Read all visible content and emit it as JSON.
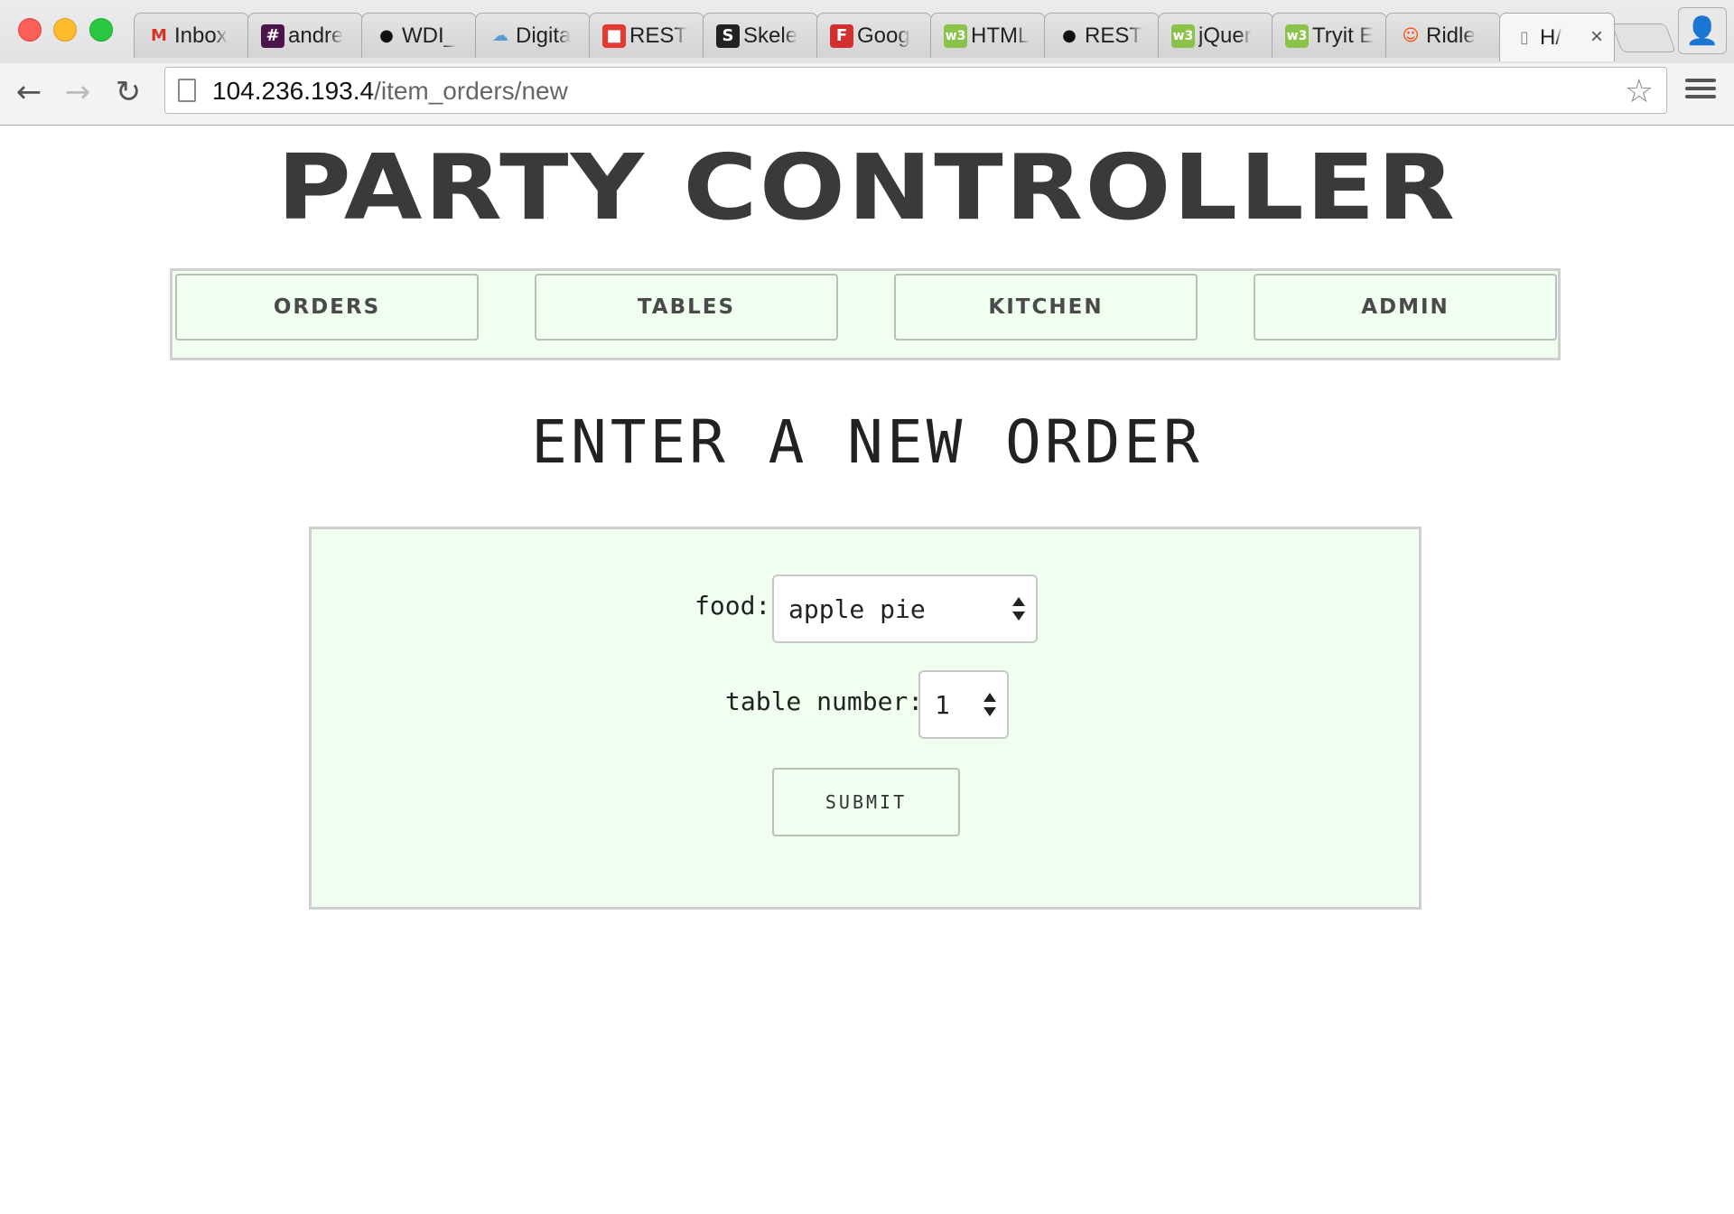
{
  "browser": {
    "tabs": [
      {
        "label": "Inbox",
        "icon": "gmail-icon",
        "icon_char": "M",
        "icon_color": "#d93025",
        "icon_bg": "transparent"
      },
      {
        "label": "andre",
        "icon": "slack-icon",
        "icon_char": "#",
        "icon_color": "#ffffff",
        "icon_bg": "#4a154b"
      },
      {
        "label": "WDI_",
        "icon": "github-icon",
        "icon_char": "●",
        "icon_color": "#111111",
        "icon_bg": "transparent"
      },
      {
        "label": "Digita",
        "icon": "cloud-icon",
        "icon_char": "☁",
        "icon_color": "#5b9bd5",
        "icon_bg": "transparent"
      },
      {
        "label": "REST",
        "icon": "rest-icon",
        "icon_char": "■",
        "icon_color": "#ffffff",
        "icon_bg": "#e53935"
      },
      {
        "label": "Skele",
        "icon": "skeleton-icon",
        "icon_char": "S",
        "icon_color": "#ffffff",
        "icon_bg": "#222222"
      },
      {
        "label": "Goog",
        "icon": "google-fonts-icon",
        "icon_char": "F",
        "icon_color": "#ffffff",
        "icon_bg": "#d32f2f"
      },
      {
        "label": "HTML",
        "icon": "w3schools-icon",
        "icon_char": "w3",
        "icon_color": "#ffffff",
        "icon_bg": "#8bc34a"
      },
      {
        "label": "REST",
        "icon": "github-icon",
        "icon_char": "●",
        "icon_color": "#111111",
        "icon_bg": "transparent"
      },
      {
        "label": "jQuer",
        "icon": "w3schools-icon",
        "icon_char": "w3",
        "icon_color": "#ffffff",
        "icon_bg": "#8bc34a"
      },
      {
        "label": "Tryit E",
        "icon": "w3schools-icon",
        "icon_char": "w3",
        "icon_color": "#ffffff",
        "icon_bg": "#8bc34a"
      },
      {
        "label": "Ridle",
        "icon": "reddit-icon",
        "icon_char": "☺",
        "icon_color": "#ff4500",
        "icon_bg": "transparent"
      },
      {
        "label": "H/",
        "icon": "page-icon",
        "icon_char": "▯",
        "icon_color": "#888888",
        "icon_bg": "transparent",
        "active": true
      }
    ],
    "url_host": "104.236.193.4",
    "url_path": "/item_orders/new"
  },
  "site": {
    "title": "PARTY CONTROLLER",
    "nav": [
      "ORDERS",
      "TABLES",
      "KITCHEN",
      "ADMIN"
    ]
  },
  "form": {
    "heading": "ENTER A NEW ORDER",
    "food_label": "food:",
    "food_value": "apple pie",
    "table_label": "table number:",
    "table_value": "1",
    "submit_label": "SUBMIT"
  },
  "colors": {
    "panel_bg": "#f0fff0",
    "title_text": "#3a3a3a"
  }
}
